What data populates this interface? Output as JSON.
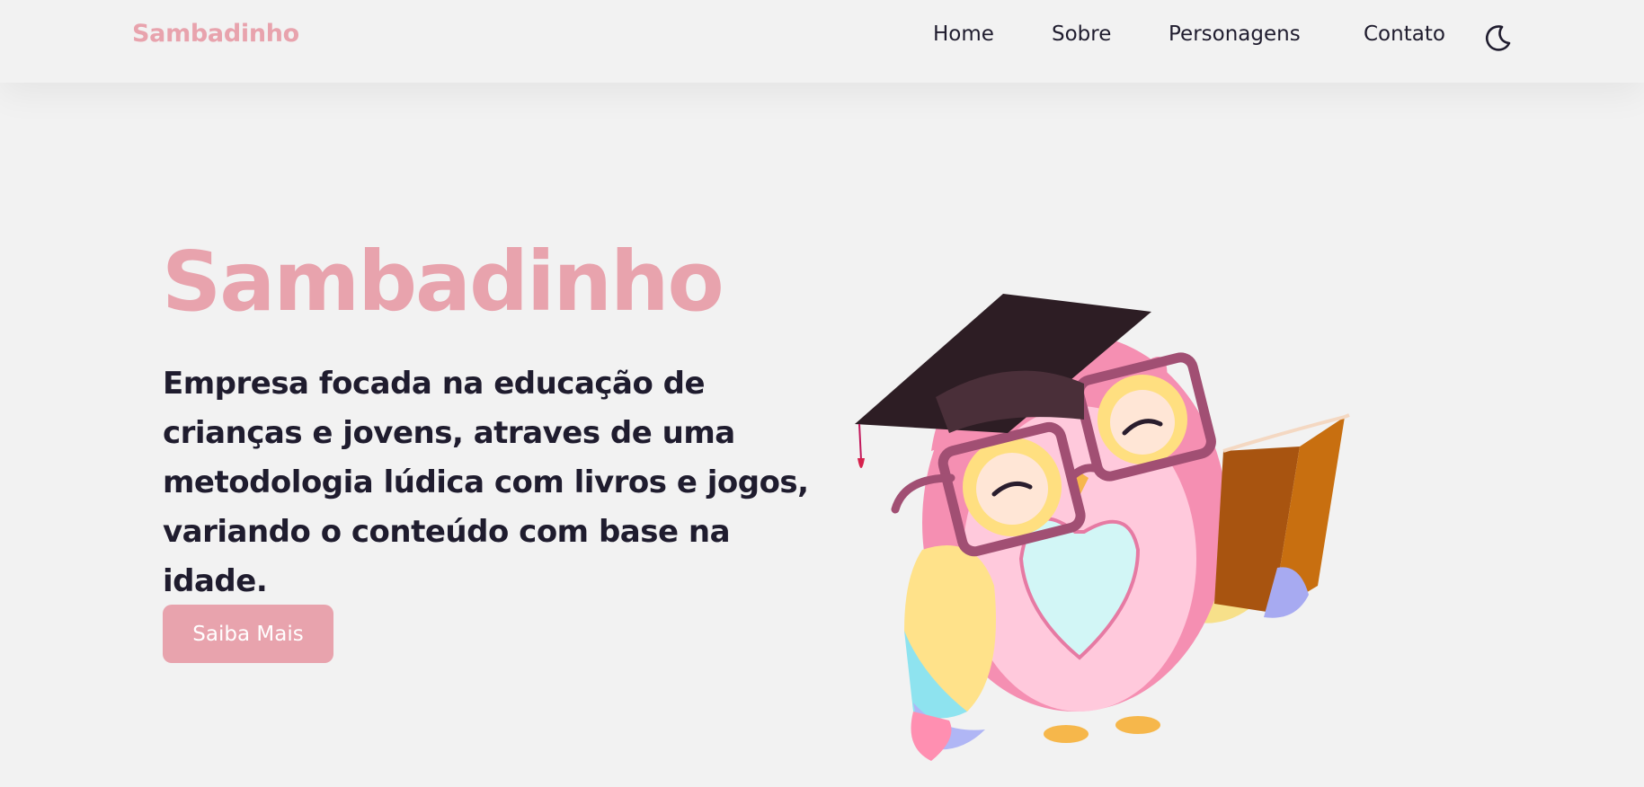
{
  "navbar": {
    "brand": "Sambadinho",
    "links": [
      "Home",
      "Sobre",
      "Personagens",
      "Contato"
    ],
    "theme_icon": "moon-icon"
  },
  "hero": {
    "title": "Sambadinho",
    "description": "Empresa focada na educação de crianças e jovens, atraves de uma metodologia lúdica com livros e jogos, variando o conteúdo com base na idade.",
    "cta_label": "Saiba Mais",
    "illustration": "owl-illustration"
  },
  "colors": {
    "accent": "#e8a3ad",
    "text": "#1f1c2e",
    "background": "#f2f2f2"
  }
}
